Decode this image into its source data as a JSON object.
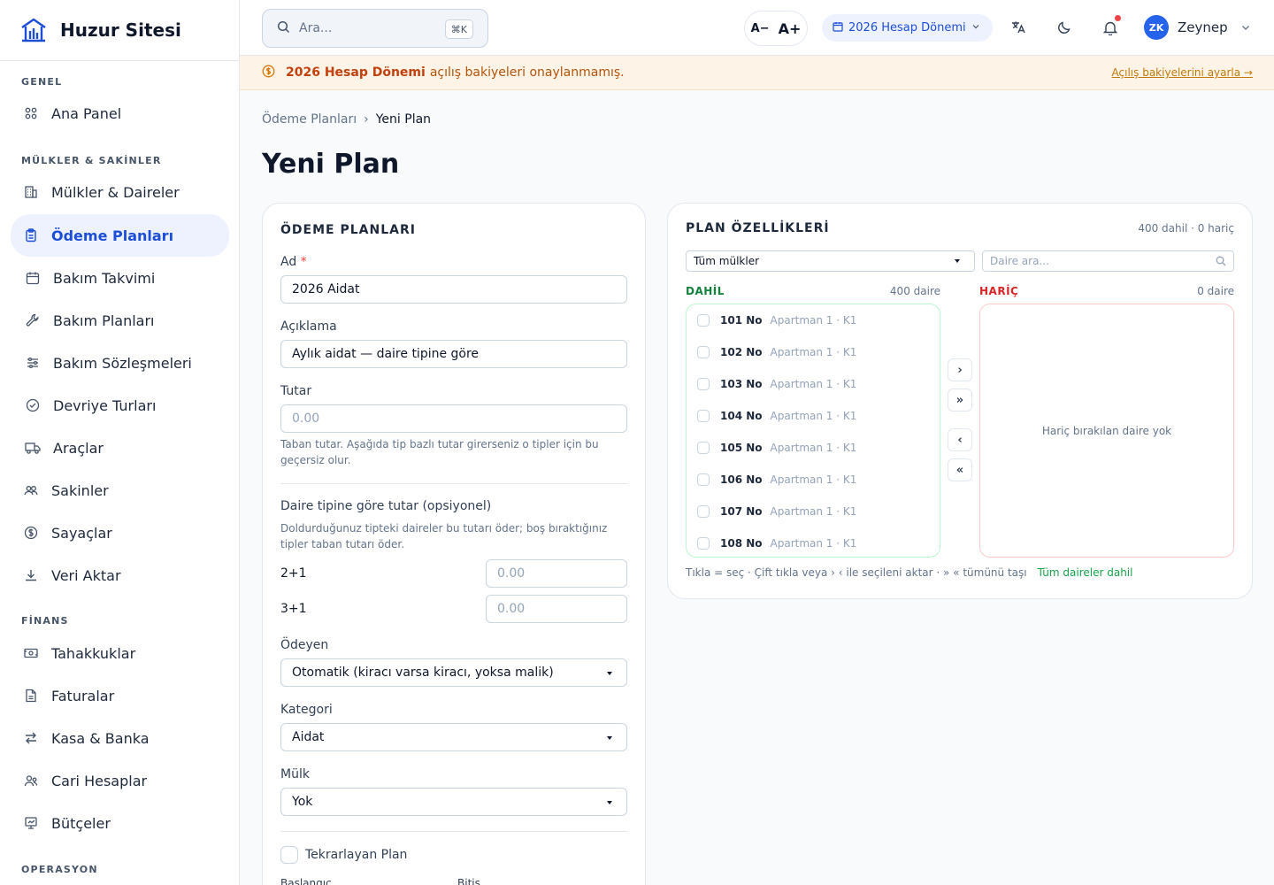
{
  "brand": {
    "name": "Huzur Sitesi"
  },
  "sidebar": {
    "sections": {
      "genel": "GENEL",
      "mulkler": "MÜLKLER & SAKİNLER",
      "finans": "FİNANS",
      "operasyon": "OPERASYON"
    },
    "items": {
      "ana_panel": "Ana Panel",
      "mulkler": "Mülkler & Daireler",
      "odeme": "Ödeme Planları",
      "bakim_takvimi": "Bakım Takvimi",
      "bakim_planlari": "Bakım Planları",
      "bakim_sozlesmeleri": "Bakım Sözleşmeleri",
      "devriye": "Devriye Turları",
      "araclar": "Araçlar",
      "sakinler": "Sakinler",
      "sayaclar": "Sayaçlar",
      "veri_aktar": "Veri Aktar",
      "tahakkuklar": "Tahakkuklar",
      "faturalar": "Faturalar",
      "kasa": "Kasa & Banka",
      "cari": "Cari Hesaplar",
      "butceler": "Bütçeler"
    }
  },
  "topbar": {
    "search_placeholder": "Ara...",
    "search_shortcut": "⌘K",
    "font_minus": "A−",
    "font_plus": "A+",
    "period": "2026 Hesap Dönemi",
    "user_initials": "ZK",
    "user_name": "Zeynep"
  },
  "banner": {
    "bold": "2026 Hesap Dönemi",
    "text": "açılış bakiyeleri onaylanmamış.",
    "link": "Açılış bakiyelerini ayarla →"
  },
  "breadcrumb": {
    "parent": "Ödeme Planları",
    "sep": "›",
    "current": "Yeni Plan"
  },
  "page": {
    "title": "Yeni Plan"
  },
  "form": {
    "title": "ÖDEME PLANLARI",
    "name_label": "Ad",
    "name_required": "*",
    "name_value": "2026 Aidat",
    "desc_label": "Açıklama",
    "desc_value": "Aylık aidat — daire tipine göre",
    "amount_label": "Tutar",
    "amount_placeholder": "0.00",
    "amount_help_1": "Taban tutar. Aşağıda tip bazlı tutar girerseniz o tipler için bu",
    "amount_help_2": "geçersiz olur.",
    "type_title": "Daire tipine göre tutar (opsiyonel)",
    "type_help_1": "Doldurduğunuz tipteki daireler bu tutarı öder; boş bıraktığınız",
    "type_help_2": "tipler taban tutarı öder.",
    "types": [
      {
        "label": "2+1",
        "placeholder": "0.00"
      },
      {
        "label": "3+1",
        "placeholder": "0.00"
      }
    ],
    "payer_label": "Ödeyen",
    "payer_value": "Otomatik (kiracı varsa kiracı, yoksa malik)",
    "category_label": "Kategori",
    "category_value": "Aidat",
    "property_label": "Mülk",
    "property_value": "Yok",
    "recurring_label": "Tekrarlayan Plan",
    "start_label": "Başlangıç",
    "end_label": "Bitiş"
  },
  "plan": {
    "title": "PLAN ÖZELLİKLERİ",
    "summary": "400 dahil · 0 hariç",
    "property_filter": "Tüm mülkler",
    "search_placeholder": "Daire ara...",
    "included_title": "DAHİL",
    "included_count": "400 daire",
    "excluded_title": "HARİÇ",
    "excluded_count": "0 daire",
    "excluded_empty": "Hariç bırakılan daire yok",
    "units": [
      {
        "no": "101 No",
        "loc": "Apartman 1 · K1"
      },
      {
        "no": "102 No",
        "loc": "Apartman 1 · K1"
      },
      {
        "no": "103 No",
        "loc": "Apartman 1 · K1"
      },
      {
        "no": "104 No",
        "loc": "Apartman 1 · K1"
      },
      {
        "no": "105 No",
        "loc": "Apartman 1 · K1"
      },
      {
        "no": "106 No",
        "loc": "Apartman 1 · K1"
      },
      {
        "no": "107 No",
        "loc": "Apartman 1 · K1"
      },
      {
        "no": "108 No",
        "loc": "Apartman 1 · K1"
      }
    ],
    "btn_move_one": "›",
    "btn_move_all": "»",
    "btn_back_one": "‹",
    "btn_back_all": "«",
    "hint": "Tıkla = seç · Çift tıkla veya › ‹ ile seçileni aktar · » « tümünü taşı",
    "status": "Tüm daireler dahil"
  }
}
